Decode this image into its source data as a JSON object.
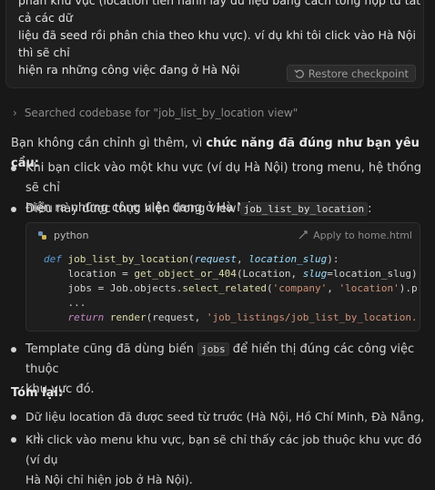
{
  "user_message": {
    "line1": "phần khu vực (location tiến hành lấy dữ liệu bằng cách tổng hợp từ tất cả các dữ",
    "line2": "liệu đã seed rồi phân chia theo khu vực). ví dụ khi tôi click vào Hà Nội thì sẽ chỉ",
    "line3": "hiện ra những công việc đang ở Hà Nội",
    "restore_label": "Restore checkpoint"
  },
  "search": {
    "label": "Searched codebase for \"job_list_by_location view\""
  },
  "reply": {
    "intro_plain": "Bạn không cần chỉnh gì thêm, vì ",
    "intro_bold": "chức năng đã đúng như bạn yêu cầu:",
    "bullet1_line1": "Khi bạn click vào một khu vực (ví dụ Hà Nội) trong menu, hệ thống sẽ chỉ",
    "bullet1_line2": "hiện ra những công việc đang ở Hà Nội.",
    "bullet2_text": "Điều này được thực hiện trong view ",
    "bullet2_code": "job_list_by_location",
    "bullet2_colon": ":",
    "bullet3_text1": "Template cũng đã dùng biến ",
    "bullet3_code": "jobs",
    "bullet3_text2": " để hiển thị đúng các công việc thuộc",
    "bullet3_line2": "khu vực đó.",
    "summary_heading": "Tóm lại:",
    "bullet4": "Dữ liệu location đã được seed từ trước (Hà Nội, Hồ Chí Minh, Đà Nẵng, ...).",
    "bullet5_line1": "Khi click vào menu khu vực, bạn sẽ chỉ thấy các job thuộc khu vực đó (ví dụ",
    "bullet5_line2": "Hà Nội chỉ hiện job ở Hà Nội)."
  },
  "code": {
    "language": "python",
    "apply_label": "Apply to home.html",
    "l1_def": "def ",
    "l1_fn": "job_list_by_location",
    "l1_p1": "request",
    "l1_p2": "location_slug",
    "l2_a": "    location = ",
    "l2_fn": "get_object_or_404",
    "l2_b": "(Location, ",
    "l2_kw": "slug",
    "l2_c": "=location_slug)",
    "l3_a": "    jobs = Job.objects.",
    "l3_fn": "select_related",
    "l3_s1": "'company'",
    "l3_s2": "'location'",
    "l3_tail": ").p",
    "l4": "    ...",
    "l5_ret": "return ",
    "l5_fn": "render",
    "l5_a": "(request, ",
    "l5_str": "'job_listings/job_list_by_location."
  },
  "icons": {
    "restore": "restore-icon",
    "chevron": "chevron-right-icon",
    "python": "python-icon",
    "apply": "apply-icon"
  }
}
